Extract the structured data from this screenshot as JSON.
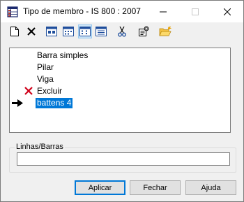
{
  "window": {
    "title": "Tipo de membro - IS 800 : 2007"
  },
  "toolbar": {
    "tools": [
      {
        "icon": "new-document-icon"
      },
      {
        "icon": "delete-x-icon"
      },
      {
        "icon": "view-large-icons-icon"
      },
      {
        "icon": "view-small-icons-icon"
      },
      {
        "icon": "view-list-icon",
        "pressed": true
      },
      {
        "icon": "view-details-icon"
      },
      {
        "icon": "scissors-icon"
      },
      {
        "icon": "properties-icon"
      },
      {
        "icon": "open-folder-icon"
      }
    ]
  },
  "member_types": [
    {
      "label": "Barra simples",
      "mark": null,
      "current": false,
      "selected": false
    },
    {
      "label": "Pilar",
      "mark": null,
      "current": false,
      "selected": false
    },
    {
      "label": "Viga",
      "mark": null,
      "current": false,
      "selected": false
    },
    {
      "label": "Excluir",
      "mark": "red-x-icon",
      "current": false,
      "selected": false
    },
    {
      "label": "battens 4",
      "mark": null,
      "current": true,
      "selected": true
    }
  ],
  "lines_group": {
    "label": "Linhas/Barras",
    "value": ""
  },
  "buttons": {
    "apply": "Aplicar",
    "close": "Fechar",
    "help": "Ajuda"
  },
  "colors": {
    "selection": "#0078d7",
    "delete_mark": "#d0021b"
  }
}
